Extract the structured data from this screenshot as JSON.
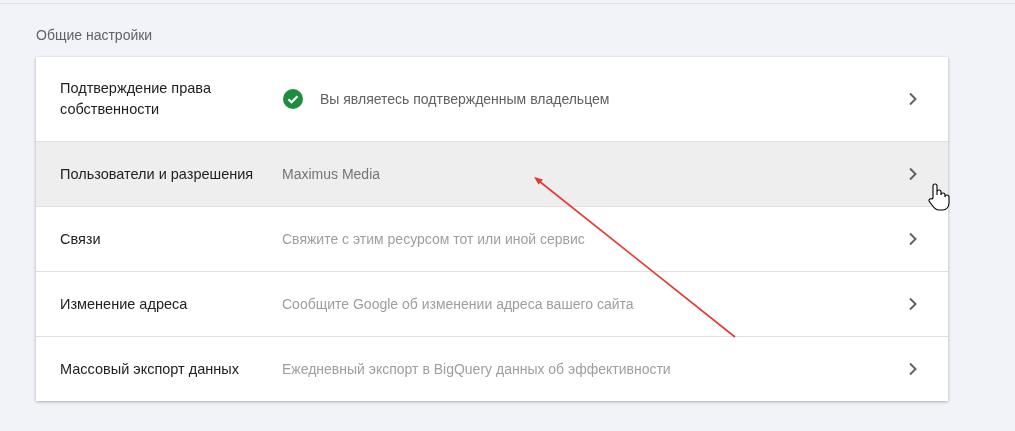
{
  "section": {
    "title": "Общие настройки"
  },
  "rows": [
    {
      "label": "Подтверждение права собственности",
      "value": "Вы являетесь подтвержденным владельцем",
      "kind": "verified",
      "selected": false
    },
    {
      "label": "Пользователи и разрешения",
      "value": "Maximus Media",
      "kind": "value",
      "selected": true
    },
    {
      "label": "Связи",
      "value": "Свяжите с этим ресурсом тот или иной сервис",
      "kind": "hint",
      "selected": false
    },
    {
      "label": "Изменение адреса",
      "value": "Сообщите Google об изменении адреса вашего сайта",
      "kind": "hint",
      "selected": false
    },
    {
      "label": "Массовый экспорт данных",
      "value": "Ежедневный экспорт в BigQuery данных об эффективности",
      "kind": "hint",
      "selected": false
    }
  ]
}
